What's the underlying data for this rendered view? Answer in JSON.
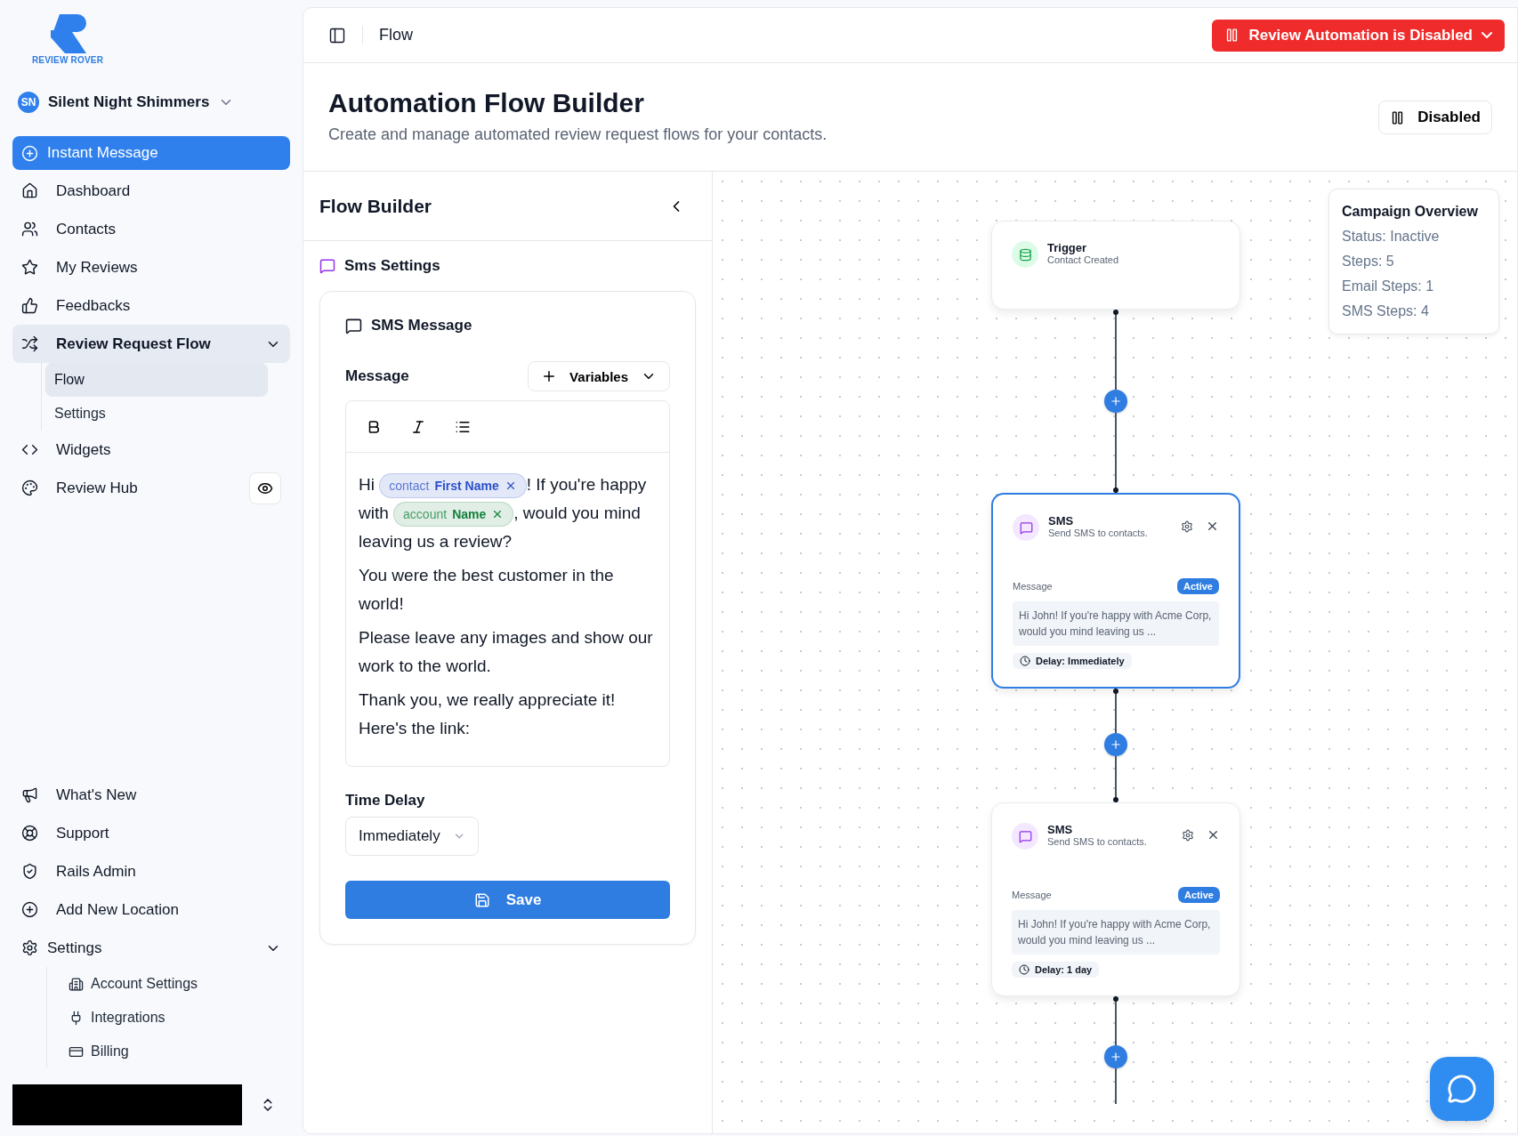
{
  "sidebar": {
    "brand": "REVIEW ROVER",
    "account": {
      "initials": "SN",
      "name": "Silent Night Shimmers"
    },
    "nav": [
      {
        "kind": "action",
        "label": "Instant Message",
        "selected": false
      },
      {
        "kind": "item",
        "label": "Dashboard",
        "selected": false
      },
      {
        "kind": "item",
        "label": "Contacts",
        "selected": false
      },
      {
        "kind": "item",
        "label": "My Reviews",
        "selected": false
      },
      {
        "kind": "item",
        "label": "Feedbacks",
        "selected": false
      },
      {
        "kind": "group",
        "label": "Review Request Flow",
        "selected": true,
        "expanded": true,
        "children": [
          {
            "label": "Flow",
            "selected": true
          },
          {
            "label": "Settings",
            "selected": false
          }
        ]
      },
      {
        "kind": "item",
        "label": "Widgets",
        "selected": false
      },
      {
        "kind": "item",
        "label": "Review Hub",
        "selected": false,
        "preview_button": true
      }
    ],
    "bottom_nav": [
      {
        "kind": "item",
        "label": "What's New",
        "selected": false
      },
      {
        "kind": "item",
        "label": "Support",
        "selected": false
      },
      {
        "kind": "item",
        "label": "Rails Admin",
        "selected": false
      },
      {
        "kind": "item",
        "label": "Add New Location",
        "selected": false
      },
      {
        "kind": "group",
        "label": "Settings",
        "selected": false,
        "expanded": true,
        "children": [
          {
            "label": "Account Settings",
            "selected": false
          },
          {
            "label": "Integrations",
            "selected": false
          },
          {
            "label": "Billing",
            "selected": false
          }
        ]
      }
    ]
  },
  "header": {
    "breadcrumb": "Flow",
    "status_button": "Review Automation is Disabled"
  },
  "page": {
    "title": "Automation Flow Builder",
    "subtitle": "Create and manage automated review request flows for your contacts.",
    "toggle_button": "Disabled"
  },
  "flow_builder": {
    "title": "Flow Builder",
    "section": "Sms Settings",
    "card_title": "SMS Message",
    "message_label": "Message",
    "variables_button": "Variables",
    "paragraphs": [
      [
        {
          "kind": "text",
          "text": "Hi "
        },
        {
          "kind": "variable",
          "prefix": "contact",
          "name": "First Name",
          "color": "#2b50c8"
        },
        {
          "kind": "text",
          "text": "! If you're happy with "
        },
        {
          "kind": "variable",
          "prefix": "account",
          "name": "Name",
          "color": "#15803d"
        },
        {
          "kind": "text",
          "text": ", would you mind leaving us a review?"
        }
      ],
      [
        {
          "kind": "text",
          "text": "You were the best customer in the world!"
        }
      ],
      [
        {
          "kind": "text",
          "text": "Please leave any images and show our work to the world."
        }
      ],
      [
        {
          "kind": "text",
          "text": "Thank you, we really appreciate it! Here's the link:"
        }
      ]
    ],
    "time_delay_label": "Time Delay",
    "time_delay": "Immediately",
    "save_button": "Save"
  },
  "canvas": {
    "nodes": [
      {
        "kind": "trigger",
        "title": "Trigger",
        "subtitle": "Contact Created",
        "selected": false
      },
      {
        "kind": "sms",
        "title": "SMS",
        "subtitle": "Send SMS to contacts.",
        "selected": true,
        "message_label": "Message",
        "status": "Active",
        "preview": "Hi John! If you're happy with Acme Corp, would you mind leaving us ...",
        "delay": "Delay: Immediately"
      },
      {
        "kind": "sms",
        "title": "SMS",
        "subtitle": "Send SMS to contacts.",
        "selected": false,
        "message_label": "Message",
        "status": "Active",
        "preview": "Hi John! If you're happy with Acme Corp, would you mind leaving us ...",
        "delay": "Delay: 1 day"
      }
    ],
    "overview": {
      "title": "Campaign Overview",
      "lines": [
        "Status: Inactive",
        "Steps: 5",
        "Email Steps: 1",
        "SMS Steps: 4"
      ]
    }
  }
}
